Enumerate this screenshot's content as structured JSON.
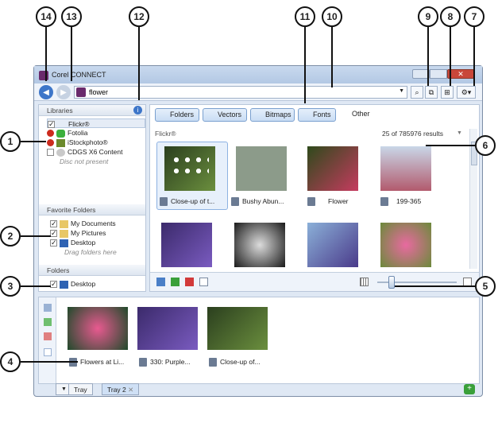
{
  "callouts": [
    "14",
    "13",
    "12",
    "11",
    "10",
    "9",
    "8",
    "7",
    "1",
    "2",
    "3",
    "4",
    "5",
    "6"
  ],
  "window": {
    "title": "Corel CONNECT"
  },
  "toolbar": {
    "search_value": "flower"
  },
  "libraries": {
    "header": "Libraries",
    "items": [
      "Flickr®",
      "Fotolia",
      "iStockphoto®",
      "CDGS X6 Content"
    ],
    "note": "Disc not present"
  },
  "favorites": {
    "header": "Favorite Folders",
    "items": [
      "My Documents",
      "My Pictures",
      "Desktop"
    ],
    "note": "Drag folders here"
  },
  "folders": {
    "header": "Folders",
    "items": [
      "Desktop"
    ]
  },
  "filters": {
    "folders": "Folders",
    "vectors": "Vectors",
    "bitmaps": "Bitmaps",
    "fonts": "Fonts",
    "other": "Other"
  },
  "results": {
    "source": "Flickr®",
    "count": "25 of 785976 results",
    "captions": [
      "Close-up of t...",
      "Bushy Abun...",
      "Flower",
      "199-365"
    ]
  },
  "tray": {
    "captions": [
      "Flowers at Li...",
      "330: Purple...",
      "Close-up of..."
    ],
    "tabs": [
      "Tray",
      "Tray 2"
    ]
  }
}
